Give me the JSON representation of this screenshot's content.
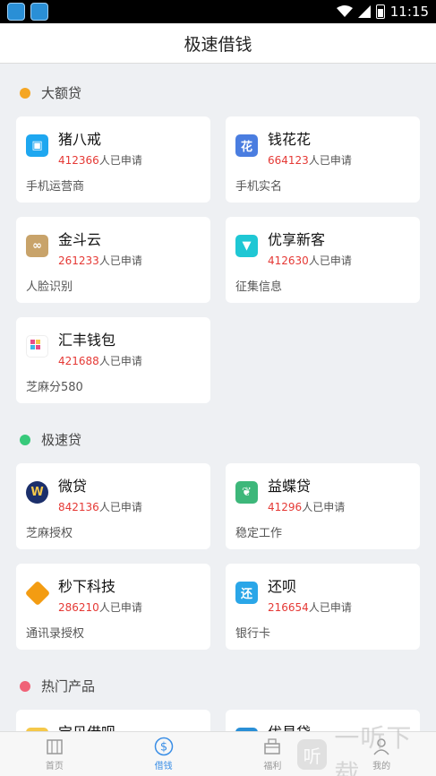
{
  "status_bar": {
    "time": "11:15"
  },
  "header": {
    "title": "极速借钱"
  },
  "sections": [
    {
      "title": "大额贷",
      "color": "#f5a623",
      "cards": [
        {
          "name": "猪八戒",
          "count": "412366",
          "suffix": "人已申请",
          "desc": "手机运营商",
          "logo_color": "#1ea7f0",
          "icon": "pig-logo"
        },
        {
          "name": "钱花花",
          "count": "664123",
          "suffix": "人已申请",
          "desc": "手机实名",
          "logo_color": "#4a7de0",
          "icon": "qianhuahua-logo"
        },
        {
          "name": "金斗云",
          "count": "261233",
          "suffix": "人已申请",
          "desc": "人脸识别",
          "logo_color": "#c8a36a",
          "icon": "cloud-logo"
        },
        {
          "name": "优享新客",
          "count": "412630",
          "suffix": "人已申请",
          "desc": "征集信息",
          "logo_color": "#1fc7d4",
          "icon": "tie-logo"
        },
        {
          "name": "汇丰钱包",
          "count": "421688",
          "suffix": "人已申请",
          "desc": "芝麻分580",
          "logo_color": "#e94c89",
          "icon": "huifeng-logo"
        }
      ]
    },
    {
      "title": "极速贷",
      "color": "#37c97a",
      "cards": [
        {
          "name": "微贷",
          "count": "842136",
          "suffix": "人已申请",
          "desc": "芝麻授权",
          "logo_color": "#1b2f6b",
          "icon": "weidai-logo"
        },
        {
          "name": "益蝶贷",
          "count": "41296",
          "suffix": "人已申请",
          "desc": "稳定工作",
          "logo_color": "#3db77a",
          "icon": "butterfly-logo"
        },
        {
          "name": "秒下科技",
          "count": "286210",
          "suffix": "人已申请",
          "desc": "通讯录授权",
          "logo_color": "#f39c12",
          "icon": "miaoxia-logo"
        },
        {
          "name": "还呗",
          "count": "216654",
          "suffix": "人已申请",
          "desc": "银行卡",
          "logo_color": "#2aa6e8",
          "icon": "huanbei-logo"
        }
      ]
    },
    {
      "title": "热门产品",
      "color": "#f06277",
      "cards": [
        {
          "name": "宝贝借呗",
          "logo_color": "#f5c84a",
          "icon": "baobei-logo"
        },
        {
          "name": "优易贷",
          "logo_color": "#2a8fd6",
          "icon": "youyi-logo"
        }
      ]
    }
  ],
  "tabs": [
    {
      "label": "首页",
      "icon": "home-icon"
    },
    {
      "label": "借钱",
      "icon": "dollar-icon"
    },
    {
      "label": "福利",
      "icon": "gift-icon"
    },
    {
      "label": "我的",
      "icon": "user-icon"
    }
  ],
  "watermark": {
    "badge": "听",
    "text": "一听下载"
  }
}
